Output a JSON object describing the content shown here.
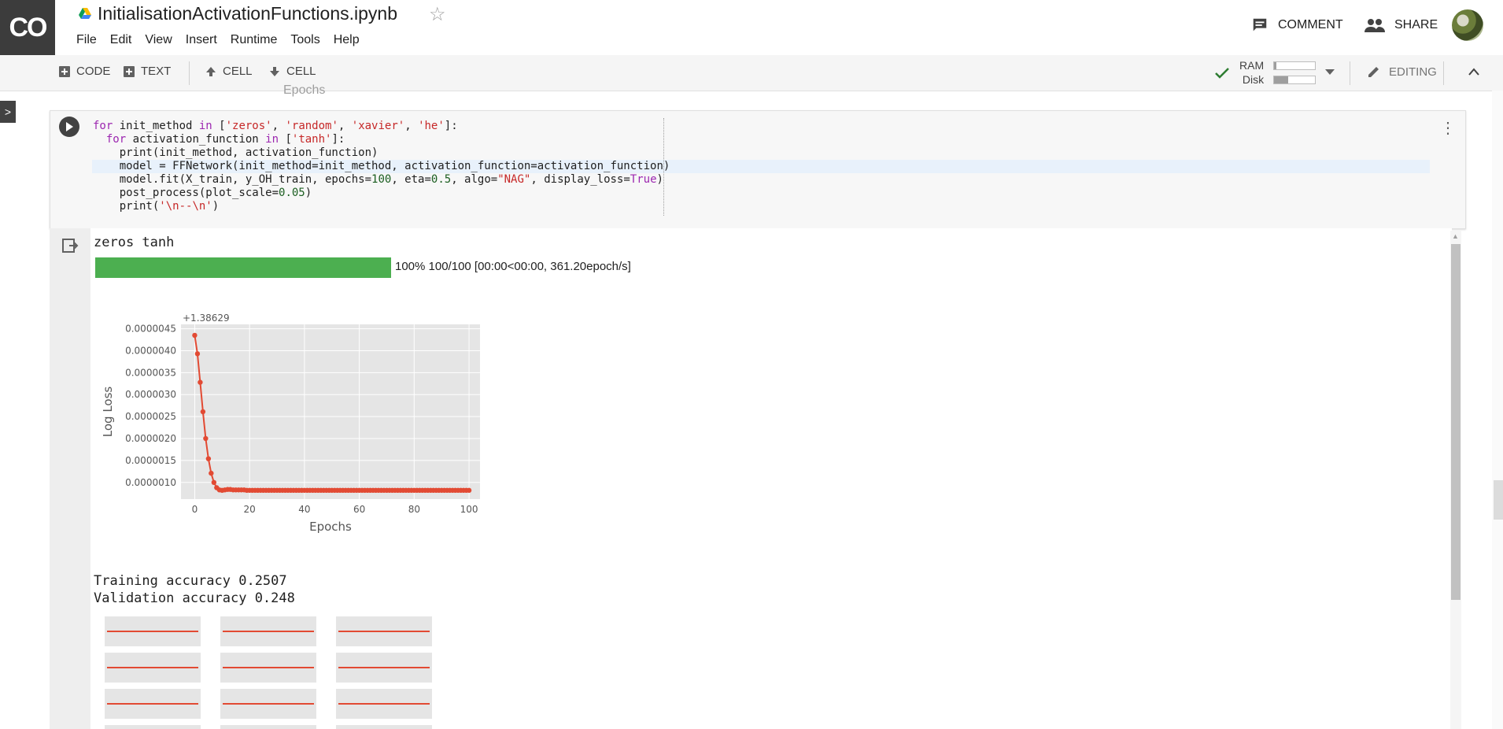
{
  "header": {
    "logo_text": "CO",
    "doc_title": "InitialisationActivationFunctions.ipynb",
    "menu": [
      "File",
      "Edit",
      "View",
      "Insert",
      "Runtime",
      "Tools",
      "Help"
    ],
    "comment_label": "COMMENT",
    "share_label": "SHARE"
  },
  "toolbar": {
    "code_label": "CODE",
    "text_label": "TEXT",
    "cell_up_label": "CELL",
    "cell_down_label": "CELL",
    "ram_label": "RAM",
    "disk_label": "Disk",
    "ram_usage": 0.05,
    "disk_usage": 0.35,
    "editing_label": "EDITING"
  },
  "notebook": {
    "ghost_label": "Epochs",
    "code_lines": [
      [
        {
          "t": "for",
          "c": "kw"
        },
        {
          "t": " init_method "
        },
        {
          "t": "in",
          "c": "kw"
        },
        {
          "t": " ["
        },
        {
          "t": "'zeros'",
          "c": "str"
        },
        {
          "t": ", "
        },
        {
          "t": "'random'",
          "c": "str"
        },
        {
          "t": ", "
        },
        {
          "t": "'xavier'",
          "c": "str"
        },
        {
          "t": ", "
        },
        {
          "t": "'he'",
          "c": "str"
        },
        {
          "t": "]:"
        }
      ],
      [
        {
          "t": "  "
        },
        {
          "t": "for",
          "c": "kw"
        },
        {
          "t": " activation_function "
        },
        {
          "t": "in",
          "c": "kw"
        },
        {
          "t": " ["
        },
        {
          "t": "'tanh'",
          "c": "str"
        },
        {
          "t": "]:"
        }
      ],
      [
        {
          "t": "    print(init_method, activation_function)"
        }
      ],
      [
        {
          "t": "    model = FFNetwork(init_method=init_method, activation_function=activation_function)"
        }
      ],
      [
        {
          "t": "    model.fit(X_train, y_OH_train, epochs="
        },
        {
          "t": "100",
          "c": "num"
        },
        {
          "t": ", eta="
        },
        {
          "t": "0.5",
          "c": "num"
        },
        {
          "t": ", algo="
        },
        {
          "t": "\"NAG\"",
          "c": "str"
        },
        {
          "t": ", display_loss="
        },
        {
          "t": "True",
          "c": "kw"
        },
        {
          "t": ")"
        }
      ],
      [
        {
          "t": "    post_process(plot_scale="
        },
        {
          "t": "0.05",
          "c": "num"
        },
        {
          "t": ")"
        }
      ],
      [
        {
          "t": "    print("
        },
        {
          "t": "'\\n--\\n'",
          "c": "str"
        },
        {
          "t": ")"
        }
      ]
    ]
  },
  "output": {
    "line1": "zeros tanh",
    "progress_fraction": 1.0,
    "progress_text": "100% 100/100 [00:00<00:00, 361.20epoch/s]",
    "train_acc": "Training accuracy 0.2507",
    "val_acc": "Validation accuracy 0.248"
  },
  "chart_data": {
    "type": "line",
    "xlabel": "Epochs",
    "ylabel": "Log Loss",
    "offset_label": "+1.38629",
    "xlim": [
      -5,
      104
    ],
    "ylim": [
      6.2e-07,
      4.6e-06
    ],
    "xticks": [
      0,
      20,
      40,
      60,
      80,
      100
    ],
    "yticks": [
      1e-06,
      1.5e-06,
      2e-06,
      2.5e-06,
      3e-06,
      3.5e-06,
      4e-06,
      4.5e-06
    ],
    "ytick_labels": [
      "0.0000010",
      "0.0000015",
      "0.0000020",
      "0.0000025",
      "0.0000030",
      "0.0000035",
      "0.0000040",
      "0.0000045"
    ],
    "series": [
      {
        "color": "#e24a33",
        "x": [
          0,
          1,
          2,
          3,
          4,
          5,
          6,
          7,
          8,
          9,
          10,
          11,
          12,
          13,
          14,
          15,
          16,
          17,
          18,
          19,
          20,
          21,
          22,
          23,
          24,
          25,
          26,
          27,
          28,
          29,
          30,
          31,
          32,
          33,
          34,
          35,
          36,
          37,
          38,
          39,
          40,
          41,
          42,
          43,
          44,
          45,
          46,
          47,
          48,
          49,
          50,
          51,
          52,
          53,
          54,
          55,
          56,
          57,
          58,
          59,
          60,
          61,
          62,
          63,
          64,
          65,
          66,
          67,
          68,
          69,
          70,
          71,
          72,
          73,
          74,
          75,
          76,
          77,
          78,
          79,
          80,
          81,
          82,
          83,
          84,
          85,
          86,
          87,
          88,
          89,
          90,
          91,
          92,
          93,
          94,
          95,
          96,
          97,
          98,
          99,
          100
        ],
        "y": [
          4.35e-06,
          3.93e-06,
          3.28e-06,
          2.61e-06,
          2e-06,
          1.54e-06,
          1.21e-06,
          1e-06,
          8.8e-07,
          8.3e-07,
          8.2e-07,
          8.3e-07,
          8.4e-07,
          8.4e-07,
          8.3e-07,
          8.3e-07,
          8.3e-07,
          8.3e-07,
          8.3e-07,
          8.2e-07,
          8.2e-07,
          8.2e-07,
          8.2e-07,
          8.2e-07,
          8.2e-07,
          8.2e-07,
          8.2e-07,
          8.2e-07,
          8.2e-07,
          8.2e-07,
          8.2e-07,
          8.2e-07,
          8.2e-07,
          8.2e-07,
          8.2e-07,
          8.2e-07,
          8.2e-07,
          8.2e-07,
          8.2e-07,
          8.2e-07,
          8.2e-07,
          8.2e-07,
          8.2e-07,
          8.2e-07,
          8.2e-07,
          8.2e-07,
          8.2e-07,
          8.2e-07,
          8.2e-07,
          8.2e-07,
          8.2e-07,
          8.2e-07,
          8.2e-07,
          8.2e-07,
          8.2e-07,
          8.2e-07,
          8.2e-07,
          8.2e-07,
          8.2e-07,
          8.2e-07,
          8.2e-07,
          8.2e-07,
          8.2e-07,
          8.2e-07,
          8.2e-07,
          8.2e-07,
          8.2e-07,
          8.2e-07,
          8.2e-07,
          8.2e-07,
          8.2e-07,
          8.2e-07,
          8.2e-07,
          8.2e-07,
          8.2e-07,
          8.2e-07,
          8.2e-07,
          8.2e-07,
          8.2e-07,
          8.2e-07,
          8.2e-07,
          8.2e-07,
          8.2e-07,
          8.2e-07,
          8.2e-07,
          8.2e-07,
          8.2e-07,
          8.2e-07,
          8.2e-07,
          8.2e-07,
          8.2e-07,
          8.2e-07,
          8.2e-07,
          8.2e-07,
          8.2e-07,
          8.2e-07,
          8.2e-07,
          8.2e-07,
          8.2e-07,
          8.2e-07,
          8.2e-07
        ]
      }
    ],
    "grid": true,
    "background": "#e5e5e5"
  },
  "mini_plots": {
    "rows": 3,
    "cols": 3,
    "line_color": "#e24a33",
    "background": "#e5e5e5"
  },
  "colors": {
    "accent": "#4caf50",
    "logo_bg": "#3c3c3c"
  },
  "icons": {
    "comment": "comment-icon",
    "share": "people-icon",
    "check": "check-icon",
    "edit": "pencil-icon"
  }
}
